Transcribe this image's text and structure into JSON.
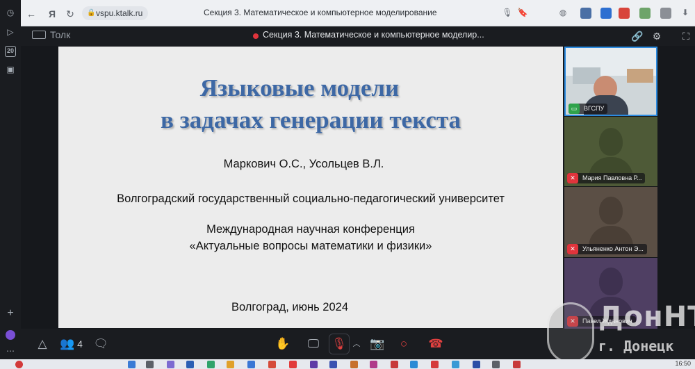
{
  "browser": {
    "url": "vspu.ktalk.ru",
    "tab_title": "Секция 3. Математическое и компьютерное моделирование"
  },
  "app": {
    "brand": "Толк",
    "conference_title": "Секция 3. Математическое и компьютерное моделир..."
  },
  "rail": {
    "badge": "20"
  },
  "slide": {
    "title_line1": "Языковые модели",
    "title_line2": "в задачах генерации текста",
    "authors": "Маркович О.С., Усольцев В.Л.",
    "university": "Волгоградский государственный социально-педагогический университет",
    "conference_line1": "Международная научная конференция",
    "conference_line2": "«Актуальные вопросы математики и физики»",
    "place_date": "Волгоград, июнь 2024"
  },
  "participants": [
    {
      "name": "ВГСПУ",
      "mic": "on"
    },
    {
      "name": "Мария Павловна Р...",
      "mic": "muted"
    },
    {
      "name": "Ульяненко Антон Э...",
      "mic": "muted"
    },
    {
      "name": "Павел Жданович",
      "mic": "muted"
    }
  ],
  "toolbar": {
    "participants_count": "4"
  },
  "watermark": {
    "text1": "ДонНТУ",
    "text2": "г. Донецк"
  },
  "taskbar": {
    "clock": "16:50"
  },
  "colors": {
    "slide_title": "#3d68a5",
    "active_speaker_border": "#2c8be0",
    "muted": "#e0343c",
    "mic_on": "#2fa34b"
  }
}
